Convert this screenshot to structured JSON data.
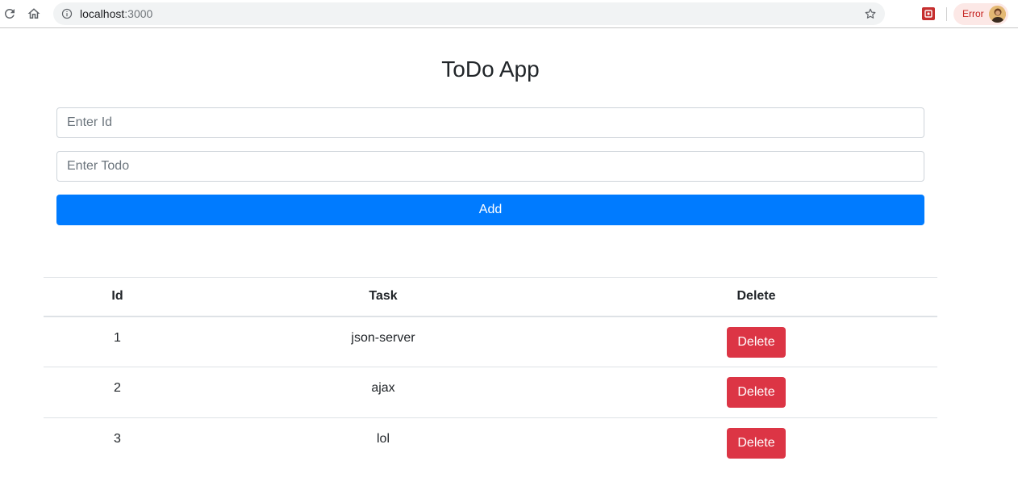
{
  "browser": {
    "url_host": "localhost",
    "url_port": ":3000",
    "profile_chip_label": "Error",
    "icons": [
      "reload-icon",
      "home-icon",
      "info-icon",
      "star-icon",
      "extension-icon",
      "avatar"
    ]
  },
  "app": {
    "title": "ToDo App",
    "id_input": {
      "value": "",
      "placeholder": "Enter Id"
    },
    "todo_input": {
      "value": "",
      "placeholder": "Enter Todo"
    },
    "add_button_label": "Add"
  },
  "table": {
    "headers": [
      "Id",
      "Task",
      "Delete"
    ],
    "rows": [
      {
        "id": "1",
        "task": "json-server",
        "action": "Delete"
      },
      {
        "id": "2",
        "task": "ajax",
        "action": "Delete"
      },
      {
        "id": "3",
        "task": "lol",
        "action": "Delete"
      }
    ]
  },
  "colors": {
    "primary": "#007bff",
    "danger": "#dc3545",
    "border": "#dee2e6",
    "error_chip_bg": "#fce8e6",
    "error_chip_text": "#c5221f"
  }
}
